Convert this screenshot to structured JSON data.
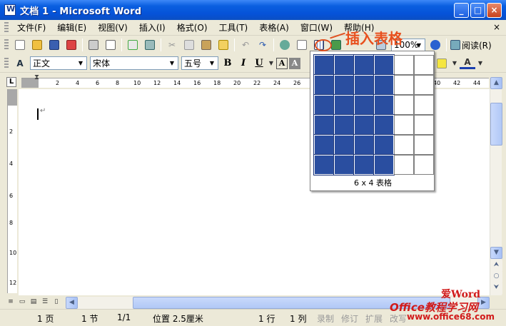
{
  "window": {
    "title": "文档 1 - Microsoft Word",
    "min": "_",
    "max": "□",
    "close": "×"
  },
  "menu": {
    "items": [
      "文件(F)",
      "编辑(E)",
      "视图(V)",
      "插入(I)",
      "格式(O)",
      "工具(T)",
      "表格(A)",
      "窗口(W)",
      "帮助(H)"
    ],
    "close_doc": "×"
  },
  "toolbar": {
    "zoom": "100%",
    "read_label": "阅读(R)"
  },
  "format": {
    "style": "正文",
    "font": "宋体",
    "size": "五号",
    "bold": "B",
    "italic": "I",
    "underline": "U",
    "char_border": "A",
    "char_shade": "A"
  },
  "ruler": {
    "tab_stop": "L",
    "h_numbers": [
      "2",
      "4",
      "6",
      "8",
      "10",
      "12",
      "14",
      "16",
      "18",
      "20",
      "22",
      "24",
      "26",
      "40",
      "42",
      "44"
    ],
    "v_numbers": [
      "2",
      "4",
      "6",
      "8",
      "10",
      "12"
    ]
  },
  "table_popup": {
    "label": "6 x 4 表格",
    "rows_selected": 6,
    "cols_selected": 4,
    "grid_rows": 6,
    "grid_cols": 6
  },
  "annotation": {
    "text": "插入表格"
  },
  "status": {
    "page": "1 页",
    "section": "1 节",
    "pages": "1/1",
    "position": "位置 2.5厘米",
    "line": "1 行",
    "column": "1 列",
    "rec": "录制",
    "trk": "修订",
    "ext": "扩展",
    "ovr": "改写"
  },
  "watermark": {
    "line1": "爱Word",
    "line2": "Office教程学习网",
    "line3": "www.office68.com"
  },
  "colors": {
    "titlebar": "#0a5fe0",
    "selected_cell": "#2a4ea0",
    "annotation": "#e8501e"
  }
}
